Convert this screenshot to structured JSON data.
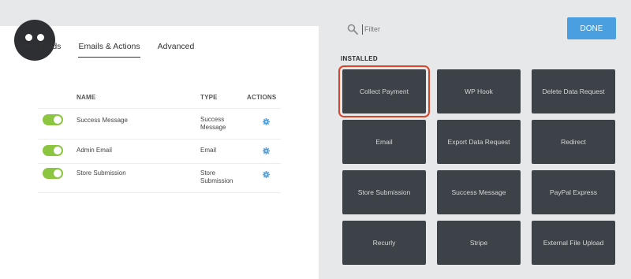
{
  "tabs": [
    {
      "label": "Form Fields",
      "active": false
    },
    {
      "label": "Emails & Actions",
      "active": true
    },
    {
      "label": "Advanced",
      "active": false
    }
  ],
  "table": {
    "headers": {
      "name": "NAME",
      "type": "TYPE",
      "actions": "ACTIONS"
    },
    "rows": [
      {
        "name": "Success Message",
        "type": "Success Message",
        "enabled": true
      },
      {
        "name": "Admin Email",
        "type": "Email",
        "enabled": true
      },
      {
        "name": "Store Submission",
        "type": "Store Submission",
        "enabled": true
      }
    ]
  },
  "filter": {
    "placeholder": "Filter"
  },
  "done_label": "DONE",
  "installed_label": "INSTALLED",
  "cards": [
    "Collect Payment",
    "WP Hook",
    "Delete Data Request",
    "Email",
    "Export Data Request",
    "Redirect",
    "Store Submission",
    "Success Message",
    "PayPal Express",
    "Recurly",
    "Stripe",
    "External File Upload"
  ],
  "highlighted_card": "Collect Payment",
  "colors": {
    "toggle_on": "#8cc540",
    "gear": "#4a9fe0",
    "done_button": "#4a9fe0",
    "card_bg": "#3c4247",
    "highlight": "#d9452b"
  },
  "icons": [
    "ninja-logo-icon",
    "search-icon",
    "gear-icon"
  ]
}
